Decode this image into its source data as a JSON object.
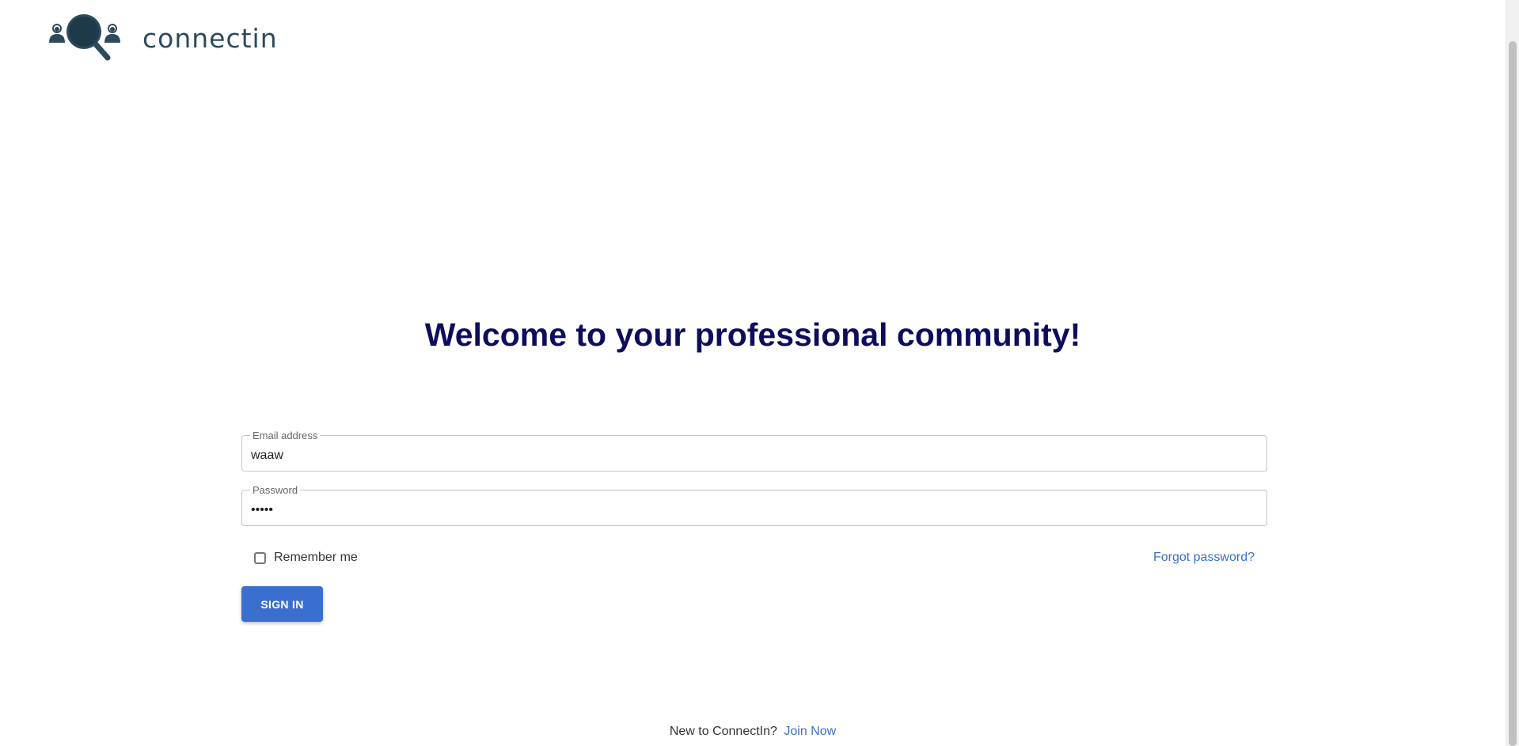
{
  "header": {
    "brand_name": "connectin",
    "logo_icon": "people-search-logo"
  },
  "main": {
    "heading": "Welcome to your professional community!"
  },
  "form": {
    "email": {
      "label": "Email address",
      "value": "waaw"
    },
    "password": {
      "label": "Password",
      "value": "•••••"
    },
    "remember_label": "Remember me",
    "remember_checked": false,
    "forgot_label": "Forgot password?",
    "submit_label": "SIGN IN"
  },
  "footer": {
    "prompt": "New to ConnectIn?",
    "join_label": "Join Now"
  },
  "colors": {
    "heading": "#0d0d5e",
    "accent": "#3b6fcf",
    "link": "#3b6fc8",
    "brand": "#2d4a5a"
  }
}
